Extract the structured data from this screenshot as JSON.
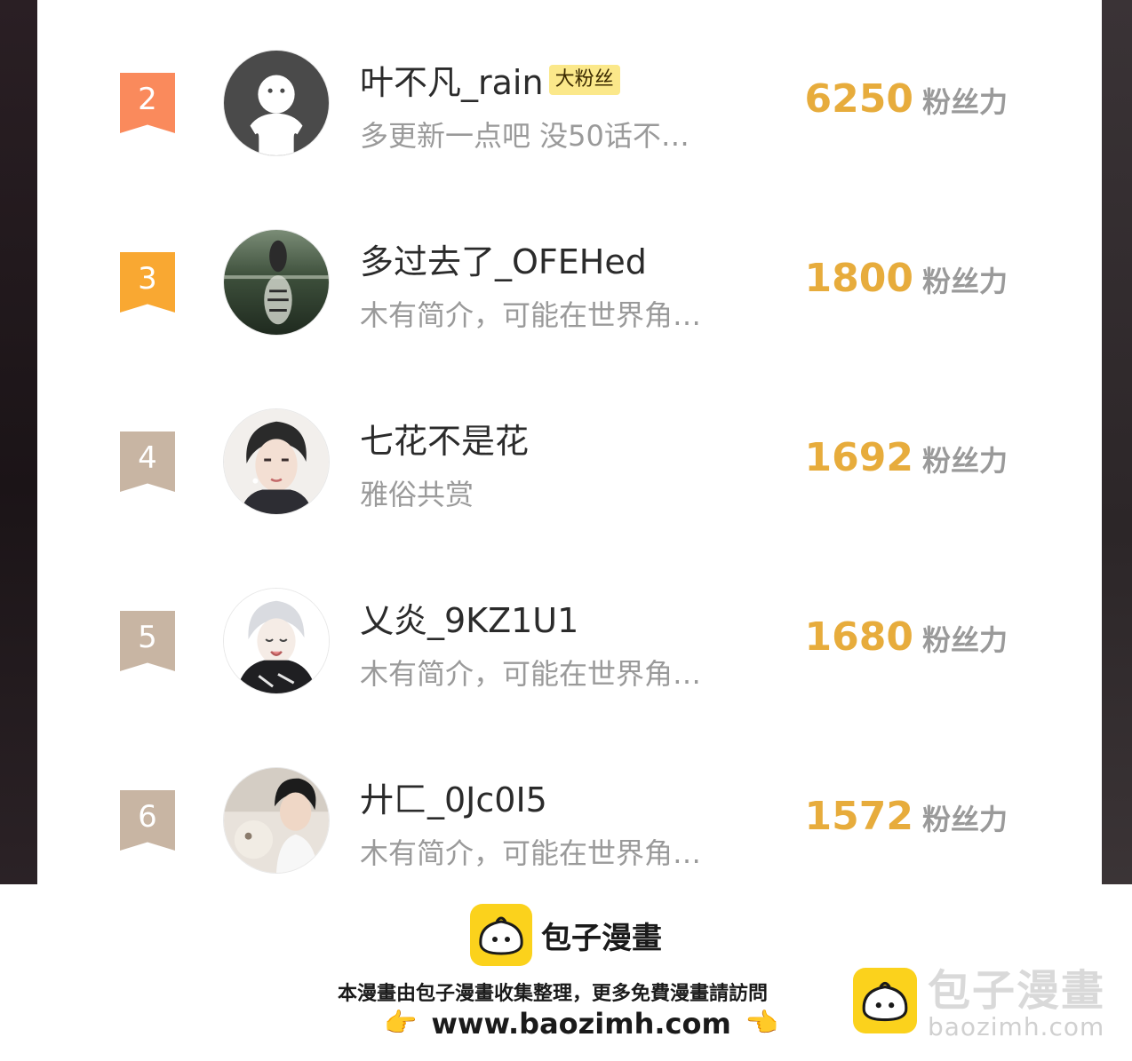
{
  "leaderboard": {
    "score_unit": "粉丝力",
    "rows": [
      {
        "rank": "2",
        "name": "叶不凡_rain",
        "badge": "大粉丝",
        "bio": "多更新一点吧 没50话不…",
        "score": "6250",
        "rank_color": "#fa8a5c",
        "avatar": "default-avatar-icon"
      },
      {
        "rank": "3",
        "name": "多过去了_OFEHed",
        "badge": "",
        "bio": "木有简介，可能在世界角…",
        "score": "1800",
        "rank_color": "#f9a832",
        "avatar": "tiger-reflection-avatar"
      },
      {
        "rank": "4",
        "name": "七花不是花",
        "badge": "",
        "bio": "雅俗共赏",
        "score": "1692",
        "rank_color": "#c8b5a3",
        "avatar": "anime-boy-avatar"
      },
      {
        "rank": "5",
        "name": "乂炎_9KZ1U1",
        "badge": "",
        "bio": "木有简介，可能在世界角…",
        "score": "1680",
        "rank_color": "#c8b5a3",
        "avatar": "white-hair-anime-avatar"
      },
      {
        "rank": "6",
        "name": "廾匚_0Jc0I5",
        "badge": "",
        "bio": "木有简介，可能在世界角…",
        "score": "1572",
        "rank_color": "#c8b5a3",
        "avatar": "boy-photo-avatar"
      }
    ]
  },
  "footer": {
    "brand": "包子漫畫",
    "credit": "本漫畫由包子漫畫收集整理，更多免費漫畫請訪問",
    "url": "www.baozimh.com",
    "hand_icon": "👉",
    "hand_icon_right": "👈"
  },
  "watermark": {
    "title": "包子漫畫",
    "subtitle": "baozimh.com"
  }
}
